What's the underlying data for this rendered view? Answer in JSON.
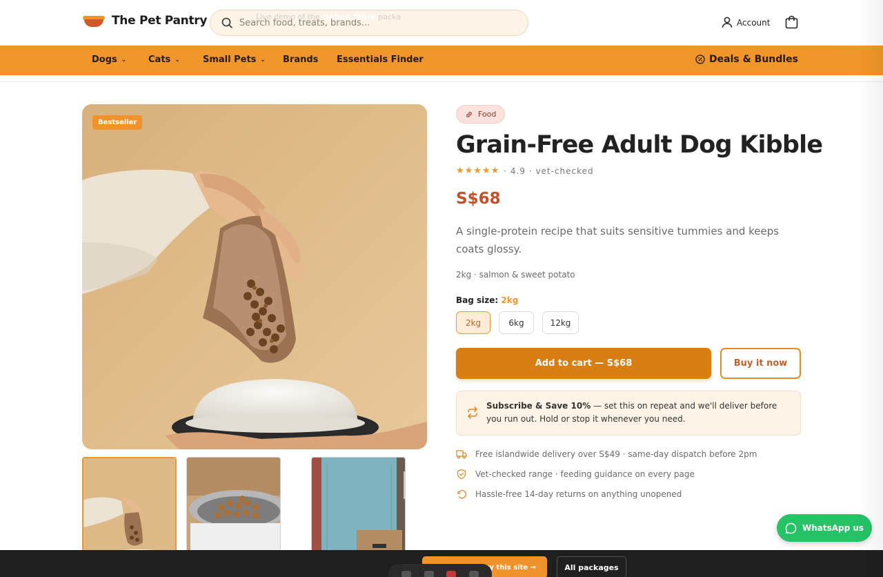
{
  "brand": {
    "name": "The Pet Pantry"
  },
  "search": {
    "placeholder": "Search food, treats, brands..."
  },
  "header": {
    "account_label": "Account"
  },
  "nav": {
    "items": [
      {
        "label": "Dogs",
        "dropdown": true
      },
      {
        "label": "Cats",
        "dropdown": true
      },
      {
        "label": "Small Pets",
        "dropdown": true
      },
      {
        "label": "Brands",
        "dropdown": false
      },
      {
        "label": "Essentials Finder",
        "dropdown": false
      }
    ],
    "deals_label": "Deals & Bundles"
  },
  "gallery": {
    "badge": "Bestseller",
    "thumbnail_count": 3
  },
  "product": {
    "category_tag": "Food",
    "title": "Grain-Free Adult Dog Kibble",
    "stars": "★★★★★",
    "rating_text": "· 4.9 · vet-checked",
    "rating": 4.9,
    "price": "S$68",
    "description": "A single-protein recipe that suits sensitive tummies and keeps coats glossy.",
    "spec": "2kg · salmon & sweet potato",
    "size_label": "Bag size:",
    "size_selected": "2kg",
    "sizes": [
      "2kg",
      "6kg",
      "12kg"
    ]
  },
  "actions": {
    "add_to_cart": "Add to cart — S$68",
    "buy_now": "Buy it now"
  },
  "subscribe": {
    "bold": "Subscribe & Save 10%",
    "text": " — set this on repeat and we'll deliver before you run out. Hold or stop it whenever you need."
  },
  "perks": [
    {
      "icon": "truck-icon",
      "text": "Free islandwide delivery over S$49 · same-day dispatch before 2pm"
    },
    {
      "icon": "shield-check-icon",
      "text": "Vet-checked range · feeding guidance on every page"
    },
    {
      "icon": "return-icon",
      "text": "Hassle-free 14-day returns on anything unopened"
    }
  ],
  "whatsapp": {
    "label": "WhatsApp us"
  },
  "demo_bar": {
    "prefix": "Live demo of the ",
    "bold": "Online Store",
    "suffix": " packa",
    "buy_label": "uy this site →",
    "all_label": "All packages"
  },
  "colors": {
    "accent": "#f0962a",
    "button": "#d97e12",
    "price": "#c0532b",
    "whatsapp": "#25c266",
    "bar": "#1f1f1f"
  }
}
